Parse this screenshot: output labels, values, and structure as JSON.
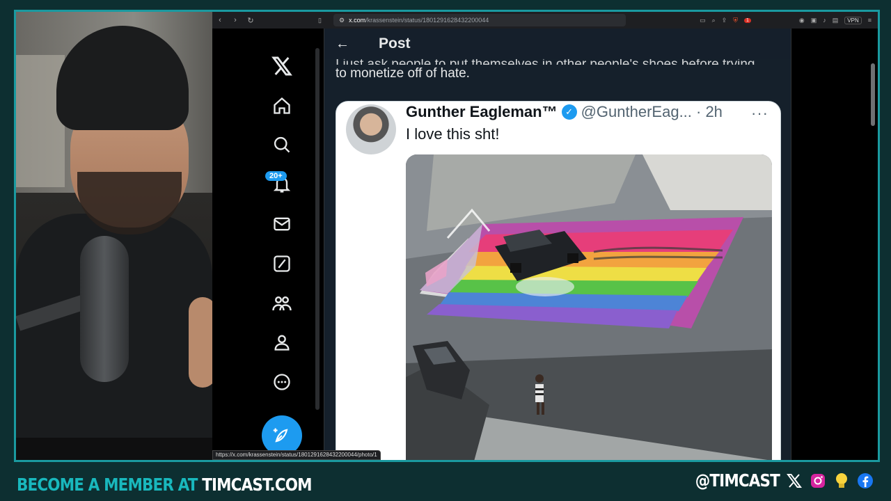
{
  "browser": {
    "url_domain": "x.com",
    "url_path": "/krassenstein/status/1801291628432200044",
    "status_url": "https://x.com/krassenstein/status/1801291628432200044/photo/1",
    "vpn_label": "VPN",
    "extension_badge": "1"
  },
  "sidebar": {
    "notification_count": "20+"
  },
  "header": {
    "title": "Post"
  },
  "post": {
    "prev_text_clipped": "I just ask people to put themselves in other people's shoes before trying",
    "prev_text": "to monetize off of hate."
  },
  "quoted": {
    "name": "Gunther Eagleman™",
    "handle_time": "@GuntherEag... · 2h",
    "text": "I love this sht!",
    "more": "···"
  },
  "banner": {
    "cta": "BECOME A MEMBER AT ",
    "site": "TIMCAST.COM",
    "handle": "@TIMCAST"
  }
}
